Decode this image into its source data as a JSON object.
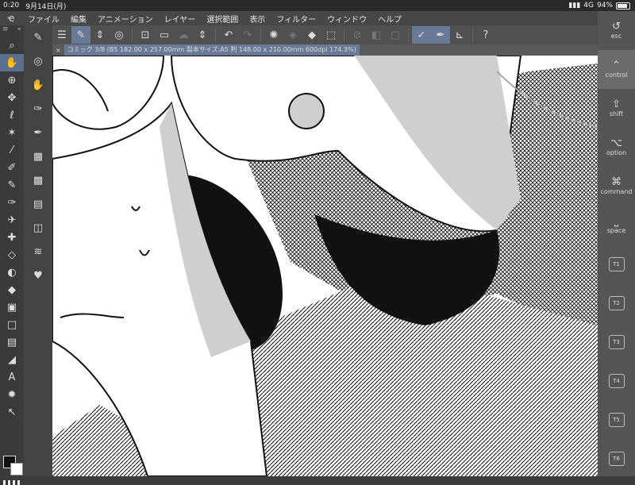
{
  "status": {
    "time": "0:20",
    "date": "9月14日(月)",
    "signal": "4G",
    "battery": "94%"
  },
  "menu": {
    "items": [
      "ファイル",
      "編集",
      "アニメーション",
      "レイヤー",
      "選択範囲",
      "表示",
      "フィルター",
      "ウィンドウ",
      "ヘルプ"
    ]
  },
  "toolbar": {
    "buttons": [
      "menu-icon",
      "draw-icon",
      "sort-icon",
      "spiral-icon",
      "new-icon",
      "open-icon",
      "save-icon",
      "updown-icon",
      "undo-icon",
      "redo-icon",
      "loading-icon",
      "transform-icon",
      "fill-icon",
      "select-icon",
      "clear-icon",
      "erase-icon",
      "frame-icon",
      "pen-stab-icon",
      "brush-stab-icon",
      "ruler-icon",
      "help-icon"
    ]
  },
  "document": {
    "tab_label": "コミック 3/8 (B5 182.00 x 257.00mm 製本サイズ:A5 判 148.00 x 210.00mm 600dpi 174.3%)"
  },
  "edge_keyboard": {
    "keys": [
      "esc",
      "control",
      "shift",
      "option",
      "command",
      "space",
      "T1",
      "T2",
      "T3",
      "T4",
      "T5",
      "T6"
    ]
  },
  "colors": {
    "accent": "#6a7a96",
    "fg": "#111111",
    "bg": "#ffffff"
  }
}
